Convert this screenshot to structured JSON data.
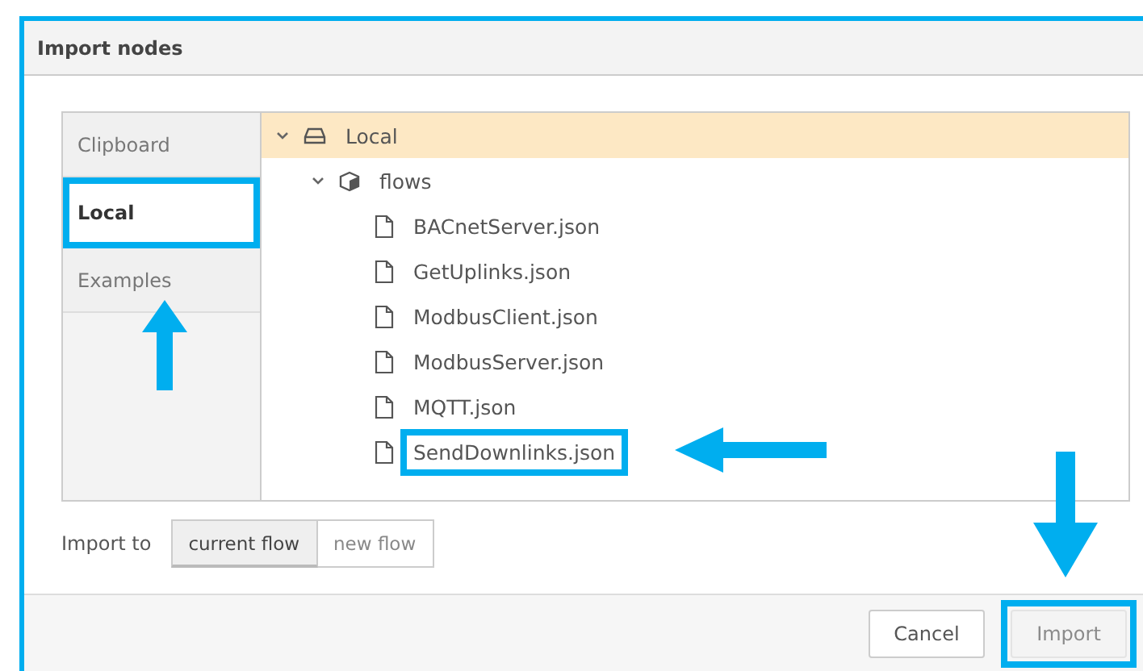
{
  "dialog": {
    "title": "Import nodes"
  },
  "tabs": [
    {
      "label": "Clipboard",
      "selected": false,
      "highlighted": false
    },
    {
      "label": "Local",
      "selected": true,
      "highlighted": true
    },
    {
      "label": "Examples",
      "selected": false,
      "highlighted": false
    }
  ],
  "tree": [
    {
      "label": "Local",
      "kind": "library",
      "expanded": true,
      "selected": true,
      "highlighted": false,
      "children": [
        {
          "label": "flows",
          "kind": "folder",
          "expanded": true,
          "selected": false,
          "highlighted": false,
          "children": [
            {
              "label": "BACnetServer.json",
              "kind": "file",
              "selected": false,
              "highlighted": false
            },
            {
              "label": "GetUplinks.json",
              "kind": "file",
              "selected": false,
              "highlighted": false
            },
            {
              "label": "ModbusClient.json",
              "kind": "file",
              "selected": false,
              "highlighted": false
            },
            {
              "label": "ModbusServer.json",
              "kind": "file",
              "selected": false,
              "highlighted": false
            },
            {
              "label": "MQTT.json",
              "kind": "file",
              "selected": false,
              "highlighted": false
            },
            {
              "label": "SendDownlinks.json",
              "kind": "file",
              "selected": false,
              "highlighted": true
            }
          ]
        }
      ]
    }
  ],
  "import_to": {
    "label": "Import to",
    "options": [
      {
        "label": "current flow",
        "selected": true
      },
      {
        "label": "new flow",
        "selected": false
      }
    ]
  },
  "buttons": [
    {
      "label": "Cancel",
      "disabled": false,
      "highlighted": false
    },
    {
      "label": "Import",
      "disabled": true,
      "highlighted": true
    }
  ]
}
